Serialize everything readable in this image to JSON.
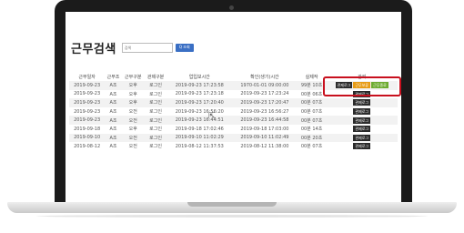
{
  "page": {
    "title": "근무검색",
    "search_placeholder": "검색",
    "search_button": "Q 조회"
  },
  "table": {
    "headers": [
      "근무일자",
      "근무조",
      "근무구분",
      "관제구분",
      "업입보시간",
      "확인(생기)시간",
      "실제작",
      "관리"
    ],
    "rows": [
      {
        "cells": [
          "2019-09-23",
          "A조",
          "오후",
          "로그인",
          "2019-09-23 17:23:58",
          "1970-01-01 09:00:00",
          "99분 10초"
        ],
        "actions": [
          "관제로그",
          "근무보류",
          "근무종료"
        ]
      },
      {
        "cells": [
          "2019-09-23",
          "A조",
          "오후",
          "로그인",
          "2019-09-23 17:23:18",
          "2019-09-23 17:23:24",
          "00분 06초"
        ],
        "actions": [
          "관제로그"
        ]
      },
      {
        "cells": [
          "2019-09-23",
          "A조",
          "오후",
          "로그인",
          "2019-09-23 17:20:40",
          "2019-09-23 17:20:47",
          "00분 07초"
        ],
        "actions": [
          "관제로그"
        ]
      },
      {
        "cells": [
          "2019-09-23",
          "A조",
          "오전",
          "로그인",
          "2019-09-23 16:56:20",
          "2019-09-23 16:56:27",
          "00분 07초"
        ],
        "actions": [
          "관제로그"
        ]
      },
      {
        "cells": [
          "2019-09-23",
          "A조",
          "오전",
          "로그인",
          "2019-09-23 16:44:51",
          "2019-09-23 16:44:58",
          "00분 07초"
        ],
        "actions": [
          "관제로그"
        ]
      },
      {
        "cells": [
          "2019-09-18",
          "A조",
          "오후",
          "로그인",
          "2019-09-18 17:02:46",
          "2019-09-18 17:03:00",
          "00분 14초"
        ],
        "actions": [
          "관제로그"
        ]
      },
      {
        "cells": [
          "2019-09-10",
          "A조",
          "오전",
          "로그인",
          "2019-09-10 11:02:29",
          "2019-09-10 11:02:49",
          "00분 20초"
        ],
        "actions": [
          "관제로그"
        ]
      },
      {
        "cells": [
          "2019-08-12",
          "A조",
          "오전",
          "로그인",
          "2019-08-12 11:37:53",
          "2019-08-12 11:38:00",
          "00분 07초"
        ],
        "actions": [
          "관제로그"
        ]
      }
    ]
  },
  "colors": {
    "highlight": "#c8101e",
    "search_button": "#3a6fc4",
    "btn_orange": "#e79b14",
    "btn_green": "#6cab2f"
  }
}
